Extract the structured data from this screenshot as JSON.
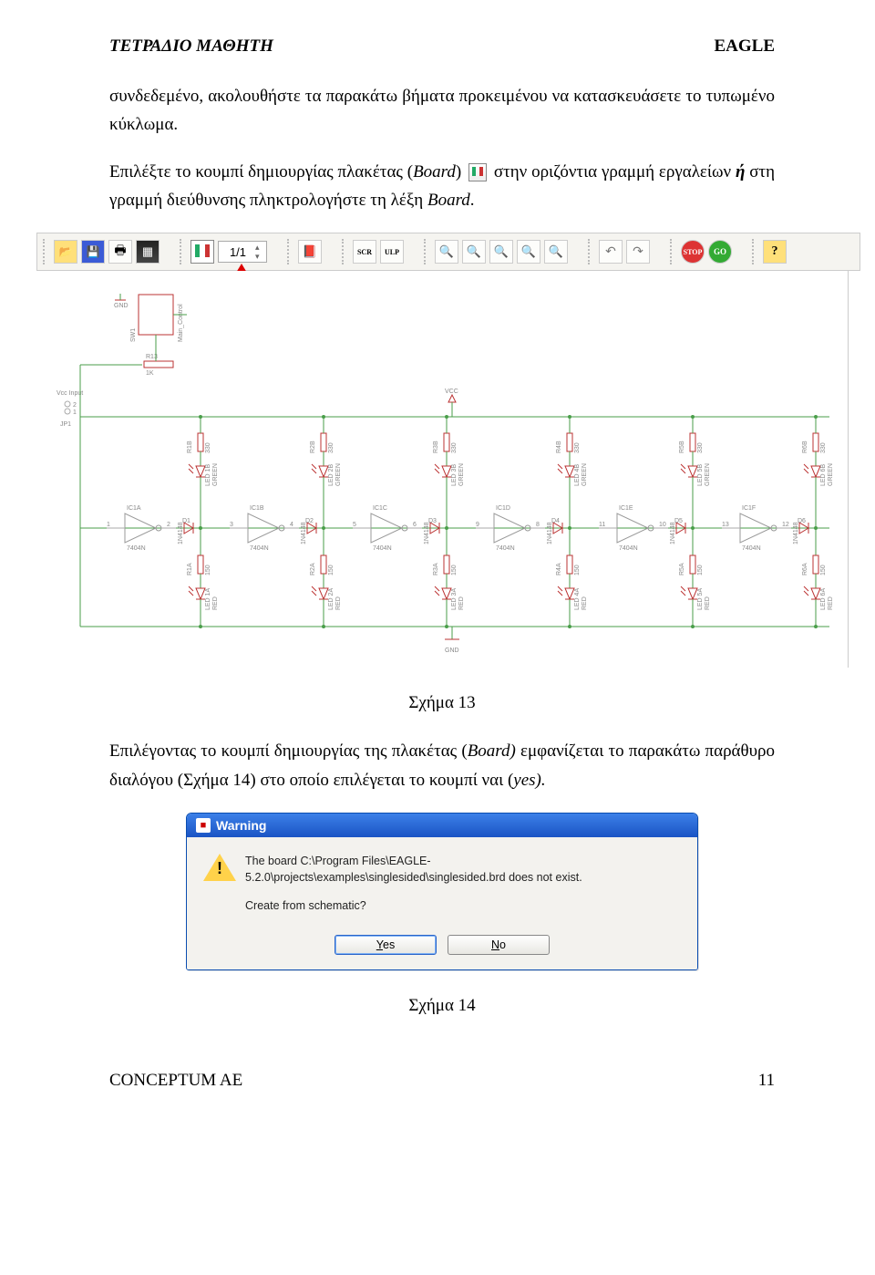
{
  "header": {
    "left": "ΤΕΤΡΑΔΙΟ ΜΑΘΗΤΗ",
    "right": "EAGLE"
  },
  "para1": "συνδεδεμένο, ακολουθήστε τα παρακάτω βήματα προκειμένου να κατασκευάσετε το τυπωμένο κύκλωμα.",
  "para2a": "Επιλέξτε το κουμπί δημιουργίας πλακέτας (",
  "para2i": "Board",
  "para2b": ") ",
  "para2c": " στην οριζόντια γραμμή εργαλείων ",
  "para2bold": "ή",
  "para2d": " στη γραμμή διεύθυνσης πληκτρολογήστε τη λέξη ",
  "para2i2": "Board",
  "para2e": ".",
  "toolbar": {
    "zoom_value": "1/1",
    "scr": "SCR",
    "ulp": "ULP",
    "stop": "STOP",
    "go": "GO",
    "help": "?"
  },
  "board_label": "Board",
  "schematic": {
    "gnd_top": "GND",
    "sw1": "SW1",
    "r13": "R13",
    "r13v": "1K",
    "vcc_input": "Vcc Input",
    "jp1": "JP1",
    "vcc": "VCC",
    "gnd_bot": "GND",
    "gates": [
      "IC1A",
      "IC1B",
      "IC1C",
      "IC1D",
      "IC1E",
      "IC1F"
    ],
    "chip": "7404N",
    "diode": "1N4148",
    "cols": [
      {
        "rb": "R1B",
        "ledb": "LED 1B",
        "green": "GREEN",
        "d": "D1",
        "ra": "R1A",
        "leda": "LED 1A",
        "red": "RED",
        "p1": "1",
        "p2": "2"
      },
      {
        "rb": "R2B",
        "ledb": "LED 2B",
        "green": "GREEN",
        "d": "D2",
        "ra": "R2A",
        "leda": "LED 2A",
        "red": "RED",
        "p1": "3",
        "p2": "4"
      },
      {
        "rb": "R3B",
        "ledb": "LED 3B",
        "green": "GREEN",
        "d": "D3",
        "ra": "R3A",
        "leda": "LED 3A",
        "red": "RED",
        "p1": "5",
        "p2": "6"
      },
      {
        "rb": "R4B",
        "ledb": "LED 4B",
        "green": "GREEN",
        "d": "D4",
        "ra": "R4A",
        "leda": "LED 4A",
        "red": "RED",
        "p1": "9",
        "p2": "8"
      },
      {
        "rb": "R5B",
        "ledb": "LED 5B",
        "green": "GREEN",
        "d": "D5",
        "ra": "R5A",
        "leda": "LED 5A",
        "red": "RED",
        "p1": "11",
        "p2": "10"
      },
      {
        "rb": "R6B",
        "ledb": "LED 6B",
        "green": "GREEN",
        "d": "D6",
        "ra": "R6A",
        "leda": "LED 6A",
        "red": "RED",
        "p1": "13",
        "p2": "12"
      }
    ],
    "rval_b": "330",
    "rval_a": "150"
  },
  "figcap13": "Σχήμα 13",
  "para3a": "Επιλέγοντας το κουμπί δημιουργίας της πλακέτας (",
  "para3i": "Board)",
  "para3b": " εμφανίζεται το παρακάτω παράθυρο διαλόγου (Σχήμα 14) στο οποίο επιλέγεται  το κουμπί ναι (",
  "para3i2": "yes).",
  "dialog": {
    "title": "Warning",
    "line1": "The board C:\\Program Files\\EAGLE-5.2.0\\projects\\examples\\singlesided\\singlesided.brd does not exist.",
    "line2": "Create from schematic?",
    "yes": "Yes",
    "no": "No"
  },
  "figcap14": "Σχήμα 14",
  "footer": {
    "left": "CONCEPTUM AE",
    "right": "11"
  }
}
